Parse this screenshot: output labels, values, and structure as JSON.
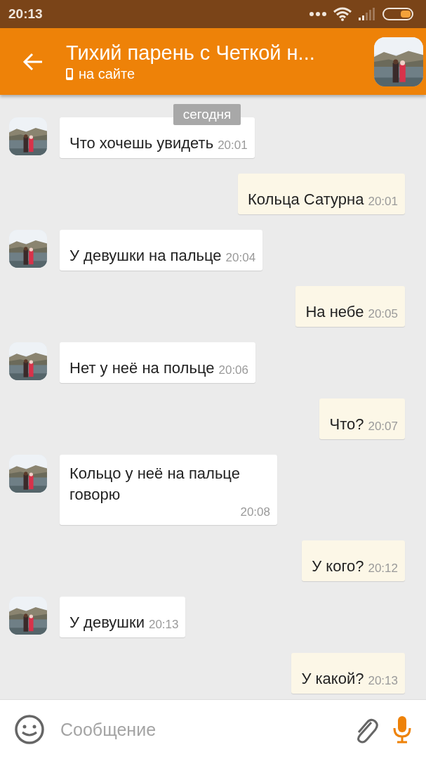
{
  "status_bar": {
    "time": "20:13"
  },
  "header": {
    "title": "Тихий парень с Четкой н...",
    "status": "на сайте"
  },
  "date_chip": "сегодня",
  "messages": [
    {
      "kind": "in",
      "text": "Что хочешь увидеть",
      "time": "20:01"
    },
    {
      "kind": "out",
      "text": "Кольца Сатурна",
      "time": "20:01"
    },
    {
      "kind": "in",
      "text": "У девушки на пальце",
      "time": "20:04"
    },
    {
      "kind": "out",
      "text": "На небе",
      "time": "20:05"
    },
    {
      "kind": "in",
      "text": "Нет у неё на польце",
      "time": "20:06"
    },
    {
      "kind": "out",
      "text": "Что?",
      "time": "20:07"
    },
    {
      "kind": "in",
      "text": "Кольцо у неё на пальце говорю",
      "time": "20:08"
    },
    {
      "kind": "out",
      "text": "У кого?",
      "time": "20:12"
    },
    {
      "kind": "in",
      "text": "У девушки",
      "time": "20:13"
    },
    {
      "kind": "out",
      "text": "У какой?",
      "time": "20:13"
    }
  ],
  "composer": {
    "placeholder": "Сообщение"
  }
}
